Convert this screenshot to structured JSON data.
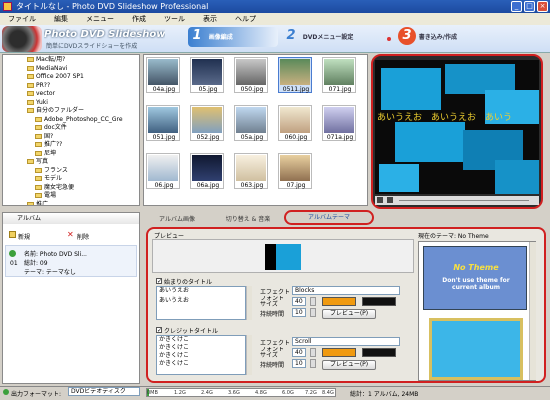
{
  "window": {
    "title": "タイトルなし - Photo DVD Slideshow Professional"
  },
  "menu": [
    "ファイル",
    "編集",
    "メニュー",
    "作成",
    "ツール",
    "表示",
    "ヘルプ"
  ],
  "header": {
    "logo_title": "Photo DVD Slideshow",
    "logo_subtitle": "簡単にDVDスライドショーを作成",
    "steps": [
      {
        "num": "1",
        "label": "画像編成"
      },
      {
        "num": "2",
        "label": "DVDメニュー設定"
      },
      {
        "num": "3",
        "label": "書き込み/作成"
      }
    ]
  },
  "tree": {
    "items": [
      "Mac転/用?",
      "MediaNavi",
      "Office 2007 SP1",
      "PR??",
      "vector",
      "Yuki",
      "自分のファルダー",
      "Adobe_Photoshop_CC_Gre",
      "doc文件",
      "国?",
      "推广??",
      "尼坤",
      "写真",
      "フランス",
      "モデル",
      "魔女宅急便",
      "電場",
      "推广"
    ]
  },
  "thumbnails": [
    "04a.jpg",
    "05.jpg",
    "050.jpg",
    "0511.jpg",
    "051.jpg",
    "052.jpg",
    "05a.jpg",
    "060.jpg",
    "06.jpg",
    "06a.jpg",
    "063.jpg",
    "07.jpg",
    "071.jpg",
    "071a.jpg"
  ],
  "preview": {
    "caption_text": "あいうえお　あいうえお　あいう"
  },
  "album_panel": {
    "tab_label": "アルバム",
    "new_label": "新規",
    "delete_label": "削除",
    "album_index": "01",
    "album_name": "名前: Photo DVD Sli...",
    "album_count": "総計: 09",
    "album_theme": "テーマ: テーマなし"
  },
  "tabs": [
    "アルバム画像",
    "切り替え & 音楽",
    "アルバムテーマ"
  ],
  "theme_editor": {
    "preview_label": "プレビュー",
    "title_check_label": "始まりのタイトル",
    "title_text_1": "あいうえお",
    "title_text_2": "あいうえお",
    "effect_label": "エフェクト",
    "effect_value_1": "Blocks",
    "font_size_label": "フォントサイズ",
    "font_size_value_1": "40",
    "duration_label": "持続時間",
    "duration_value_1": "10",
    "preview_button": "プレビュー(P)",
    "credit_check_label": "クレジットタイトル",
    "credit_text_1": "かきくけこ",
    "credit_text_2": "かきくけこ",
    "credit_text_3": "かきくけこ",
    "credit_text_4": "かきくけこ",
    "effect_value_2": "Scroll",
    "font_size_value_2": "40",
    "duration_value_2": "10"
  },
  "current_theme": {
    "label": "現在のテーマ: No Theme",
    "card_title": "No Theme",
    "card_text": "Don't use theme for current album"
  },
  "status": {
    "output_label": "出力フォーマット:",
    "output_value": "DVDビデオディスク",
    "ruler": [
      "0MB",
      "1.2G",
      "2.4G",
      "3.6G",
      "4.8G",
      "6.0G",
      "7.2G",
      "8.4G"
    ],
    "total": "総計：1 アルバム, 24MB"
  },
  "colors": {
    "accent_red": "#d02020",
    "title_blue": "#1c4aa0",
    "theme_card": "#6b8fd1"
  }
}
